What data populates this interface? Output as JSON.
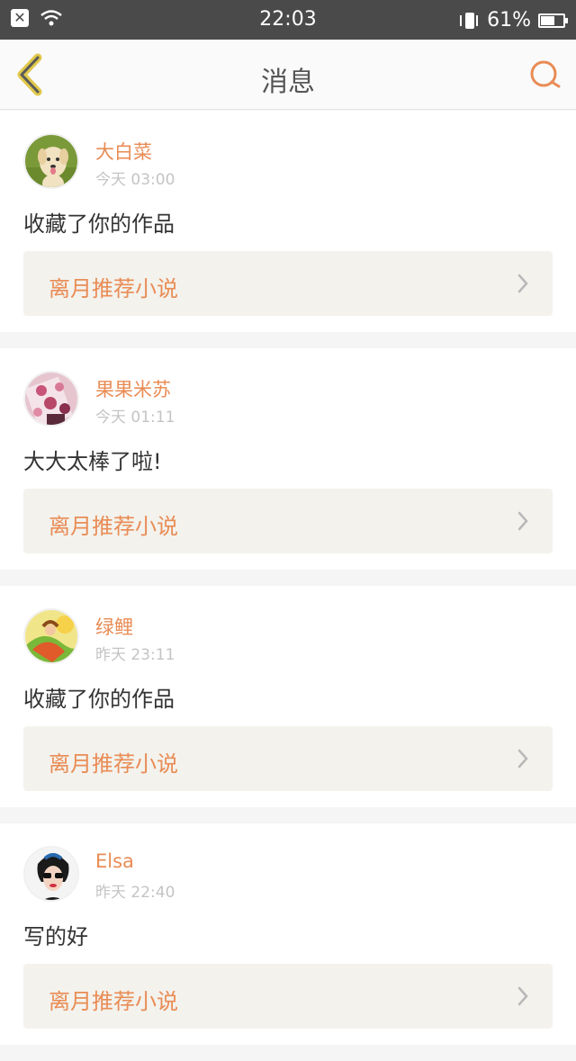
{
  "status_bar": {
    "time": "22:03",
    "battery_percent_label": "61%",
    "battery_level": 0.61
  },
  "header": {
    "title": "消息"
  },
  "messages": [
    {
      "username": "大白菜",
      "time": "今天 03:00",
      "content": "收藏了你的作品",
      "link_label": "离月推荐小说"
    },
    {
      "username": "果果米苏",
      "time": "今天 01:11",
      "content": "大大太棒了啦!",
      "link_label": "离月推荐小说"
    },
    {
      "username": "绿鲤",
      "time": "昨天 23:11",
      "content": "收藏了你的作品",
      "link_label": "离月推荐小说"
    },
    {
      "username": "Elsa",
      "time": "昨天 22:40",
      "content": "写的好",
      "link_label": "离月推荐小说"
    }
  ],
  "colors": {
    "accent": "#e98c55",
    "back_icon_stroke": "#e0c84a",
    "status_bar": "#4a4a4a"
  },
  "icons": {
    "back": "chevron-left-icon",
    "search": "search-icon"
  }
}
